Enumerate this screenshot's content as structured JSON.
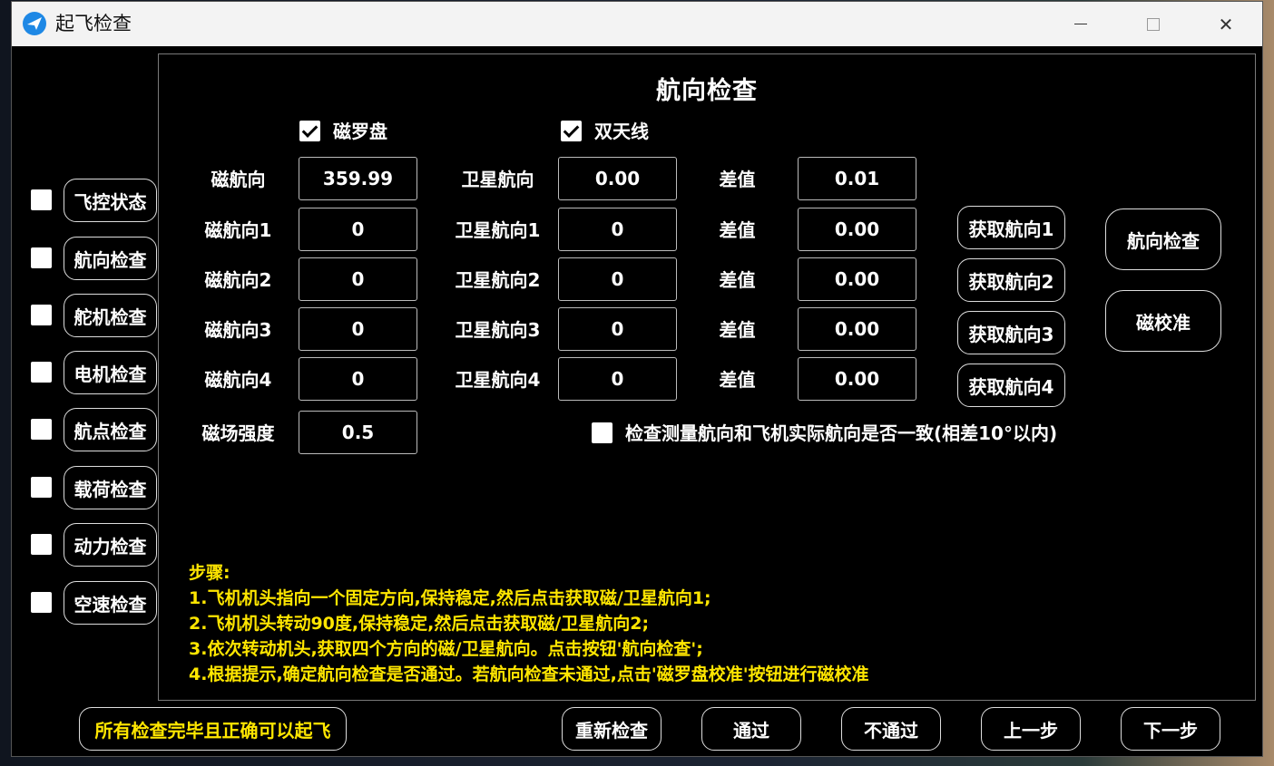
{
  "window": {
    "title": "起飞检查",
    "controls": {
      "minimize": "minimize",
      "maximize": "maximize",
      "close": "✕"
    }
  },
  "sidebar": {
    "items": [
      {
        "label": "飞控状态",
        "checked": false
      },
      {
        "label": "航向检查",
        "checked": false
      },
      {
        "label": "舵机检查",
        "checked": false
      },
      {
        "label": "电机检查",
        "checked": false
      },
      {
        "label": "航点检查",
        "checked": false
      },
      {
        "label": "载荷检查",
        "checked": false
      },
      {
        "label": "动力检查",
        "checked": false
      },
      {
        "label": "空速检查",
        "checked": false
      }
    ]
  },
  "heading": {
    "title": "航向检查",
    "compass_option": {
      "label": "磁罗盘",
      "checked": true
    },
    "dual_antenna_option": {
      "label": "双天线",
      "checked": true
    },
    "rows": [
      {
        "mag_label": "磁航向",
        "mag_value": "359.99",
        "sat_label": "卫星航向",
        "sat_value": "0.00",
        "diff_label": "差值",
        "diff_value": "0.01"
      },
      {
        "mag_label": "磁航向1",
        "mag_value": "0",
        "sat_label": "卫星航向1",
        "sat_value": "0",
        "diff_label": "差值",
        "diff_value": "0.00",
        "get_button": "获取航向1"
      },
      {
        "mag_label": "磁航向2",
        "mag_value": "0",
        "sat_label": "卫星航向2",
        "sat_value": "0",
        "diff_label": "差值",
        "diff_value": "0.00",
        "get_button": "获取航向2"
      },
      {
        "mag_label": "磁航向3",
        "mag_value": "0",
        "sat_label": "卫星航向3",
        "sat_value": "0",
        "diff_label": "差值",
        "diff_value": "0.00",
        "get_button": "获取航向3"
      },
      {
        "mag_label": "磁航向4",
        "mag_value": "0",
        "sat_label": "卫星航向4",
        "sat_value": "0",
        "diff_label": "差值",
        "diff_value": "0.00",
        "get_button": "获取航向4"
      }
    ],
    "field_strength": {
      "label": "磁场强度",
      "value": "0.5"
    },
    "consistency_check": {
      "label": "检查测量航向和飞机实际航向是否一致(相差10°以内)",
      "checked": false
    },
    "heading_check_button": "航向检查",
    "mag_calibration_button": "磁校准",
    "steps": [
      "步骤:",
      "1.飞机机头指向一个固定方向,保持稳定,然后点击获取磁/卫星航向1;",
      "2.飞机机头转动90度,保持稳定,然后点击获取磁/卫星航向2;",
      "3.依次转动机头,获取四个方向的磁/卫星航向。点击按钮'航向检查';",
      "4.根据提示,确定航向检查是否通过。若航向检查未通过,点击'磁罗盘校准'按钮进行磁校准"
    ]
  },
  "footer": {
    "final_button": "所有检查完毕且正确可以起飞",
    "recheck": "重新检查",
    "pass": "通过",
    "fail": "不通过",
    "prev": "上一步",
    "next": "下一步"
  },
  "colors": {
    "steps_text": "#ffe600",
    "background": "#000000",
    "titlebar": "#f3f3f3"
  }
}
